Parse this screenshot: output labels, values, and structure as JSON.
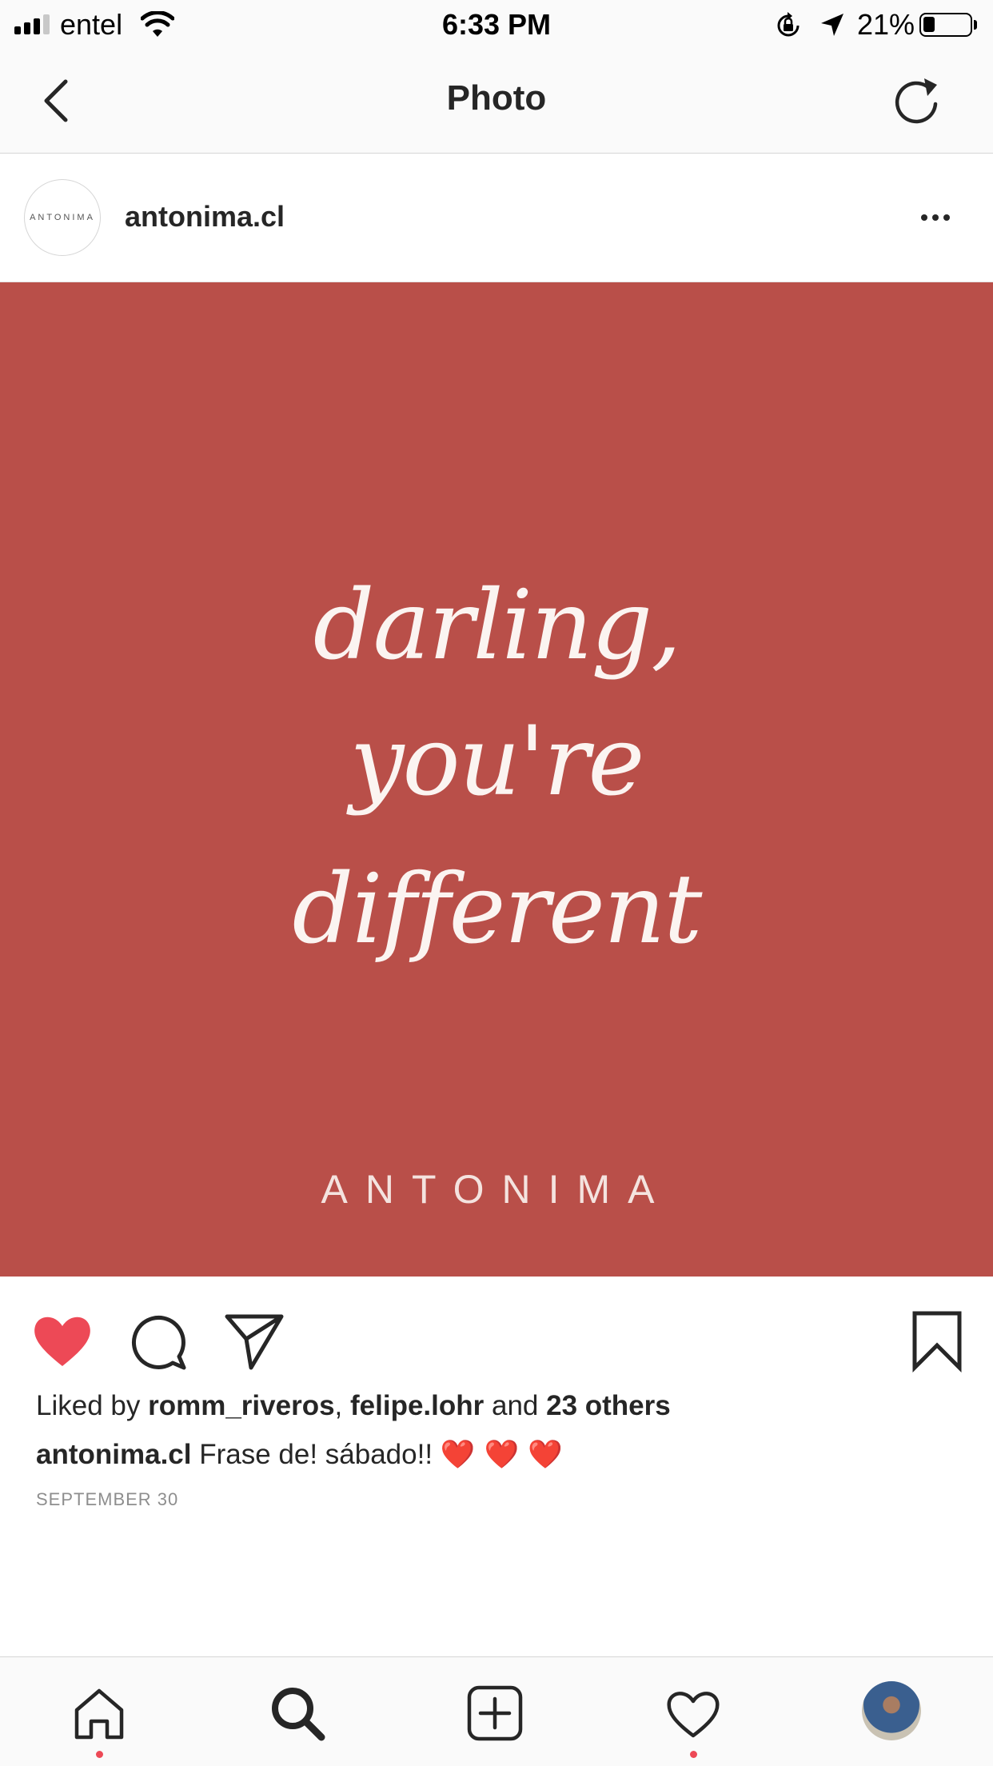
{
  "status_bar": {
    "carrier": "entel",
    "time": "6:33 PM",
    "battery_percent": "21%",
    "battery_level": 0.21,
    "icons": [
      "signal-icon",
      "wifi-icon",
      "rotation-lock-icon",
      "location-arrow-icon",
      "battery-icon"
    ]
  },
  "nav": {
    "title": "Photo",
    "back_icon": "chevron-left-icon",
    "refresh_icon": "refresh-icon"
  },
  "post": {
    "username": "antonima.cl",
    "avatar_text": "ANTONIMA",
    "image": {
      "background_color": "#b94f49",
      "lines": [
        "darling,",
        "you're",
        "different"
      ],
      "brand": "ANTONIMA"
    },
    "liked": true,
    "likes": {
      "prefix": "Liked by ",
      "user1": "romm_riveros",
      "separator": ", ",
      "user2": "felipe.lohr",
      "conjunction": " and ",
      "others": "23 others"
    },
    "caption": {
      "username": "antonima.cl",
      "text": " Frase de! sábado!! ",
      "emoji": "❤️ ❤️ ❤️"
    },
    "date": "SEPTEMBER 30"
  },
  "tab_bar": {
    "items": [
      "home-icon",
      "search-icon",
      "new-post-icon",
      "activity-icon",
      "profile-avatar"
    ],
    "badge_color": "#ed4956"
  },
  "colors": {
    "like_red": "#ed4956",
    "text": "#262626",
    "muted": "#8e8e8e"
  }
}
